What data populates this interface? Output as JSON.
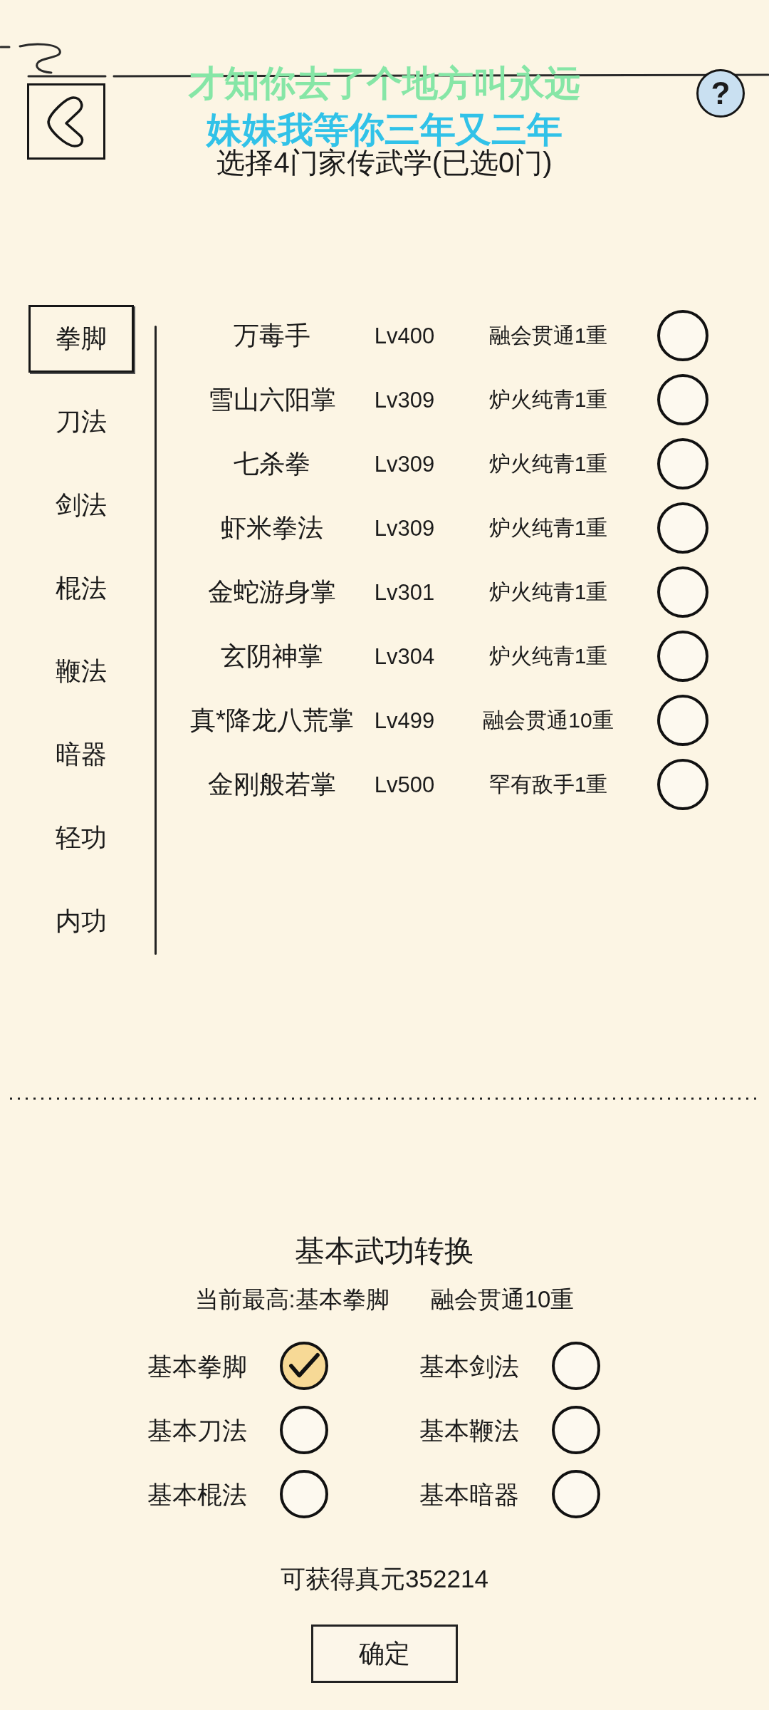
{
  "lyrics": [
    {
      "text": "才知你去了个地方叫永远",
      "selected": false
    },
    {
      "text": "妹妹我等你三年又三年",
      "selected": true
    }
  ],
  "header": {
    "title": "选择4门家传武学(已选0门)",
    "help_button": "?"
  },
  "categories": [
    {
      "label": "拳脚",
      "selected": true
    },
    {
      "label": "刀法",
      "selected": false
    },
    {
      "label": "剑法",
      "selected": false
    },
    {
      "label": "棍法",
      "selected": false
    },
    {
      "label": "鞭法",
      "selected": false
    },
    {
      "label": "暗器",
      "selected": false
    },
    {
      "label": "轻功",
      "selected": false
    },
    {
      "label": "内功",
      "selected": false
    }
  ],
  "skills": [
    {
      "name": "万毒手",
      "lv": "Lv400",
      "realm": "融会贯通1重",
      "selected": false
    },
    {
      "name": "雪山六阳掌",
      "lv": "Lv309",
      "realm": "炉火纯青1重",
      "selected": false
    },
    {
      "name": "七杀拳",
      "lv": "Lv309",
      "realm": "炉火纯青1重",
      "selected": false
    },
    {
      "name": "虾米拳法",
      "lv": "Lv309",
      "realm": "炉火纯青1重",
      "selected": false
    },
    {
      "name": "金蛇游身掌",
      "lv": "Lv301",
      "realm": "炉火纯青1重",
      "selected": false
    },
    {
      "name": "玄阴神掌",
      "lv": "Lv304",
      "realm": "炉火纯青1重",
      "selected": false
    },
    {
      "name": "真*降龙八荒掌",
      "lv": "Lv499",
      "realm": "融会贯通10重",
      "selected": false
    },
    {
      "name": "金刚般若掌",
      "lv": "Lv500",
      "realm": "罕有敌手1重",
      "selected": false
    }
  ],
  "conversion": {
    "title": "基本武功转换",
    "current_best": "当前最高:基本拳脚",
    "current_realm": "融会贯通10重",
    "options": [
      {
        "label": "基本拳脚",
        "checked": true
      },
      {
        "label": "基本剑法",
        "checked": false
      },
      {
        "label": "基本刀法",
        "checked": false
      },
      {
        "label": "基本鞭法",
        "checked": false
      },
      {
        "label": "基本棍法",
        "checked": false
      },
      {
        "label": "基本暗器",
        "checked": false
      }
    ],
    "reward": "可获得真元352214",
    "confirm_button": "确定"
  }
}
